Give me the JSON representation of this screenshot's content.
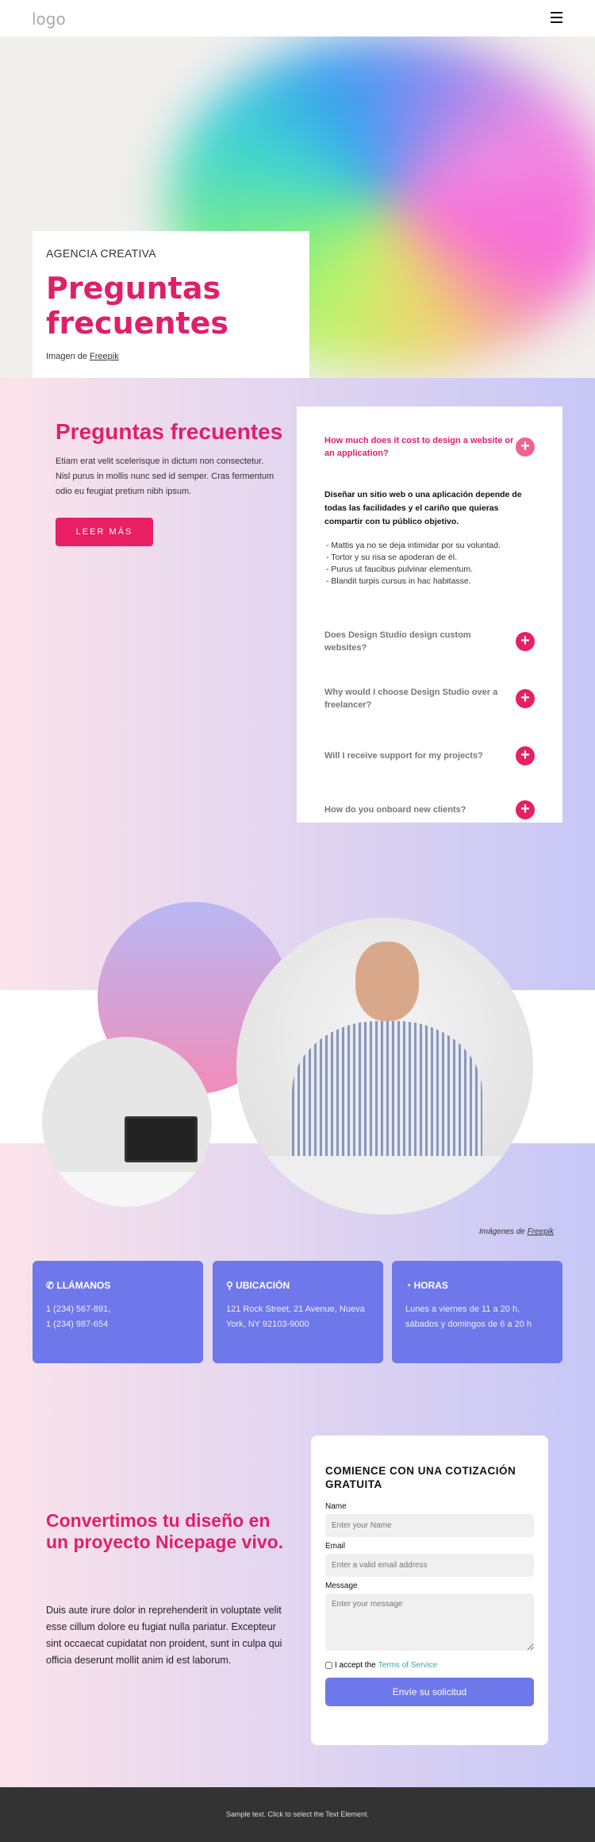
{
  "header": {
    "logo": "logo",
    "menu_icon": "hamburger-icon"
  },
  "hero": {
    "eyebrow": "AGENCIA CREATIVA",
    "title": "Preguntas frecuentes",
    "credit_prefix": "Imagen de ",
    "credit_link": "Freepik"
  },
  "faq_intro": {
    "title": "Preguntas frecuentes",
    "text": "Etiam erat velit scelerisque in dictum non consectetur. Nisl purus in mollis nunc sed id semper. Cras fermentum odio eu feugiat pretium nibh ipsum.",
    "button": "LEER MÁS"
  },
  "faq": {
    "items": [
      {
        "question": "How much does it cost to design a website or an application?"
      },
      {
        "question": "Does Design Studio design custom websites?"
      },
      {
        "question": "Why would I choose Design Studio over a freelancer?"
      },
      {
        "question": "Will I receive support for my projects?"
      },
      {
        "question": "How do you onboard new clients?"
      }
    ],
    "answer": "Diseñar un sitio web o una aplicación depende de todas las facilidades y el cariño que quieras compartir con tu público objetivo.",
    "bullets": [
      "Mattis ya no se deja intimidar por su voluntad.",
      "Tortor y su risa se apoderan de él.",
      "Purus ut faucibus pulvinar elementum.",
      "Blandit turpis cursus in hac habitasse."
    ]
  },
  "images_credit": {
    "prefix": "Imágenes de ",
    "link": "Freepik"
  },
  "info": [
    {
      "icon": "phone-icon",
      "title": "LLÁMANOS",
      "line1": "1 (234) 567-891,",
      "line2": "1 (234) 987-654"
    },
    {
      "icon": "location-pin-icon",
      "title": "UBICACIÓN",
      "line1": "121 Rock Street, 21 Avenue, Nueva",
      "line2": "York, NY 92103-9000"
    },
    {
      "icon": "clock-icon",
      "title": "HORAS",
      "line1": "Lunes a viernes de 11 a 20 h,",
      "line2": "sábados y domingos de 6 a 20 h"
    }
  ],
  "cta": {
    "title": "Convertimos tu diseño en un proyecto Nicepage vivo.",
    "text": "Duis aute irure dolor in reprehenderit in voluptate velit esse cillum dolore eu fugiat nulla pariatur. Excepteur sint occaecat cupidatat non proident, sunt in culpa qui officia deserunt mollit anim id est laborum."
  },
  "form": {
    "title": "COMIENCE CON UNA COTIZACIÓN GRATUITA",
    "name_label": "Name",
    "name_placeholder": "Enter your Name",
    "email_label": "Email",
    "email_placeholder": "Enter a valid email address",
    "message_label": "Message",
    "message_placeholder": "Enter your message",
    "terms_prefix": "I accept the ",
    "terms_link": "Terms of Service",
    "submit": "Envíe su solicitud"
  },
  "footer": {
    "text": "Sample text. Click to select the Text Element."
  },
  "colors": {
    "accent": "#e01f6a",
    "card": "#6e78ea",
    "footer": "#333333"
  }
}
